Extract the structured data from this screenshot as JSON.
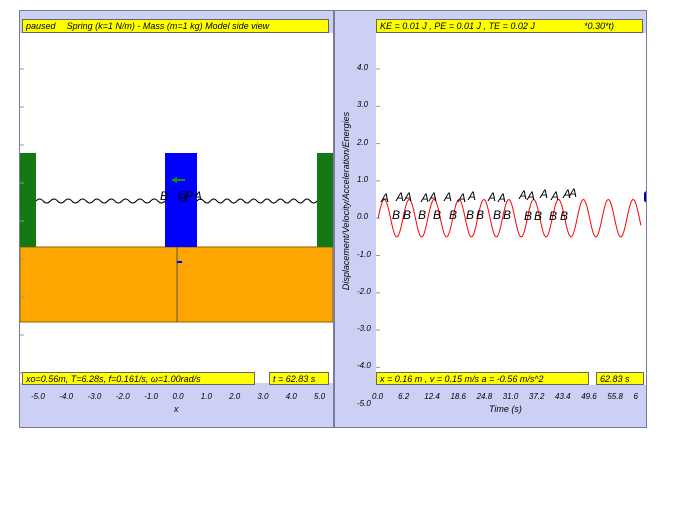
{
  "left_panel": {
    "status": "paused",
    "title": "Spring (k=1 N/m) - Mass (m=1 kg) Model side view",
    "info": "xo=0.56m, T=6.28s, f=0.161/s, ω=1.00rad/s",
    "time": "t = 62.83 s",
    "x_ticks": [
      "-5.0",
      "-4.0",
      "-3.0",
      "-2.0",
      "-1.0",
      "0.0",
      "1.0",
      "2.0",
      "3.0",
      "4.0",
      "5.0"
    ],
    "x_label": "x",
    "mass_labels": [
      "B",
      "@",
      "P",
      "A"
    ],
    "colors": {
      "wall": "#147814",
      "mass": "#0000ff",
      "floor": "#ffa500",
      "label_bg": "#ffff00"
    }
  },
  "right_panel": {
    "energy": "KE = 0.01 J , PE = 0.01 J , TE = 0.02 J",
    "energy_tail": "*0.30*t)",
    "readout": "x = 0.16 m , v = 0.15 m/s a = -0.56 m/s^2",
    "time": "62.83 s",
    "y_label": "Displacement/Velocity/Acceleration/Energies",
    "x_label": "Time (s)",
    "y_ticks": [
      "4.0",
      "3.0",
      "2.0",
      "1.0",
      "0.0",
      "-1.0",
      "-2.0",
      "-3.0",
      "-4.0",
      "-5.0"
    ],
    "x_ticks": [
      "0.0",
      "6.2",
      "12.4",
      "18.6",
      "24.8",
      "31.0",
      "37.2",
      "43.4",
      "49.6",
      "55.8",
      "6"
    ],
    "plot_labels_a": [
      "A",
      "A",
      "A",
      "A",
      "A",
      "A",
      "A",
      "A",
      "A",
      "A",
      "A",
      "A",
      "A",
      "A",
      "A",
      "A"
    ],
    "plot_labels_b": [
      "B",
      "B",
      "B",
      "B",
      "B",
      "B",
      "B",
      "B",
      "B",
      "B",
      "B",
      "B",
      "B"
    ],
    "wave_color": "#ff0000"
  },
  "chart_data": {
    "type": "line",
    "xlabel": "Time (s)",
    "ylabel": "Displacement/Velocity/Acceleration/Energies",
    "xlim": [
      0,
      62.83
    ],
    "ylim": [
      -5,
      5
    ],
    "series": [
      {
        "amplitude": 0.5,
        "period": 5.9
      }
    ]
  }
}
